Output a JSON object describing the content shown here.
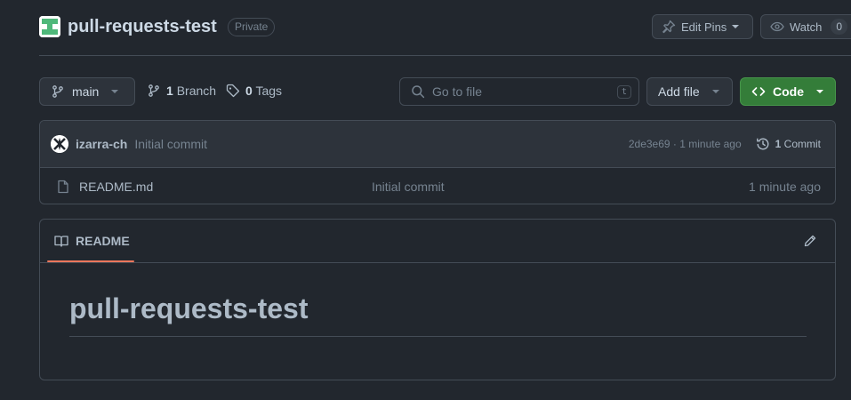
{
  "header": {
    "repo_name": "pull-requests-test",
    "visibility": "Private",
    "edit_pins_label": "Edit Pins",
    "watch_label": "Watch",
    "watch_count": "0"
  },
  "toolbar": {
    "branch_name": "main",
    "branch_count": "1",
    "branch_label": "Branch",
    "tag_count": "0",
    "tag_label": "Tags",
    "search_placeholder": "Go to file",
    "search_shortcut": "t",
    "add_file_label": "Add file",
    "code_label": "Code"
  },
  "latest_commit": {
    "author": "izarra-ch",
    "message": "Initial commit",
    "meta": "2de3e69 · 1 minute ago",
    "commit_count": "1",
    "commit_label": "Commit"
  },
  "files": [
    {
      "name": "README.md",
      "commit_message": "Initial commit",
      "age": "1 minute ago"
    }
  ],
  "readme": {
    "tab_label": "README",
    "title": "pull-requests-test"
  },
  "colors": {
    "background": "#22272e",
    "accent_green": "#347d39",
    "tab_underline": "#ec775c",
    "border": "#444c56"
  },
  "icons": {
    "repo_avatar": "identicon-icon",
    "pin": "pin-icon",
    "watch": "eye-icon",
    "branch": "git-branch-icon",
    "tag": "tag-icon",
    "search": "search-icon",
    "code": "code-icon",
    "history": "history-icon",
    "file": "file-icon",
    "book": "book-icon",
    "edit": "pencil-icon"
  }
}
